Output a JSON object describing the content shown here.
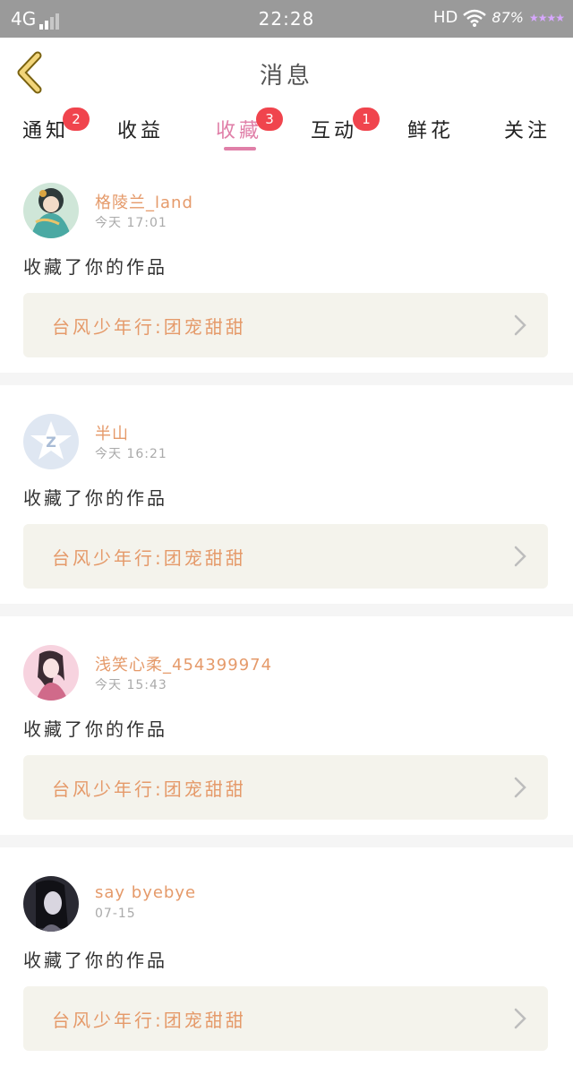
{
  "status_bar": {
    "network": "4G",
    "time": "22:28",
    "hd": "HD",
    "battery": "87%"
  },
  "header": {
    "title": "消息"
  },
  "tabs": [
    {
      "label": "通知",
      "badge": "2"
    },
    {
      "label": "收益",
      "badge": ""
    },
    {
      "label": "收藏",
      "badge": "3"
    },
    {
      "label": "互动",
      "badge": "1"
    },
    {
      "label": "鲜花",
      "badge": ""
    },
    {
      "label": "关注",
      "badge": ""
    }
  ],
  "active_tab": "收藏",
  "messages": [
    {
      "username": "格陵兰_land",
      "time": "今天 17:01",
      "action": "收藏了你的作品",
      "work": "台风少年行:团宠甜甜",
      "avatar": "character-illustration"
    },
    {
      "username": "半山",
      "time": "今天 16:21",
      "action": "收藏了你的作品",
      "work": "台风少年行:团宠甜甜",
      "avatar": "qq-default-avatar"
    },
    {
      "username": "浅笑心柔_454399974",
      "time": "今天 15:43",
      "action": "收藏了你的作品",
      "work": "台风少年行:团宠甜甜",
      "avatar": "anime-girl-pink"
    },
    {
      "username": "say byebye",
      "time": "07-15",
      "action": "收藏了你的作品",
      "work": "台风少年行:团宠甜甜",
      "avatar": "dark-portrait"
    }
  ],
  "colors": {
    "accent": "#e07fa8",
    "username": "#e59a6a",
    "badge": "#f0444d",
    "work_box": "#f4f3ec"
  }
}
